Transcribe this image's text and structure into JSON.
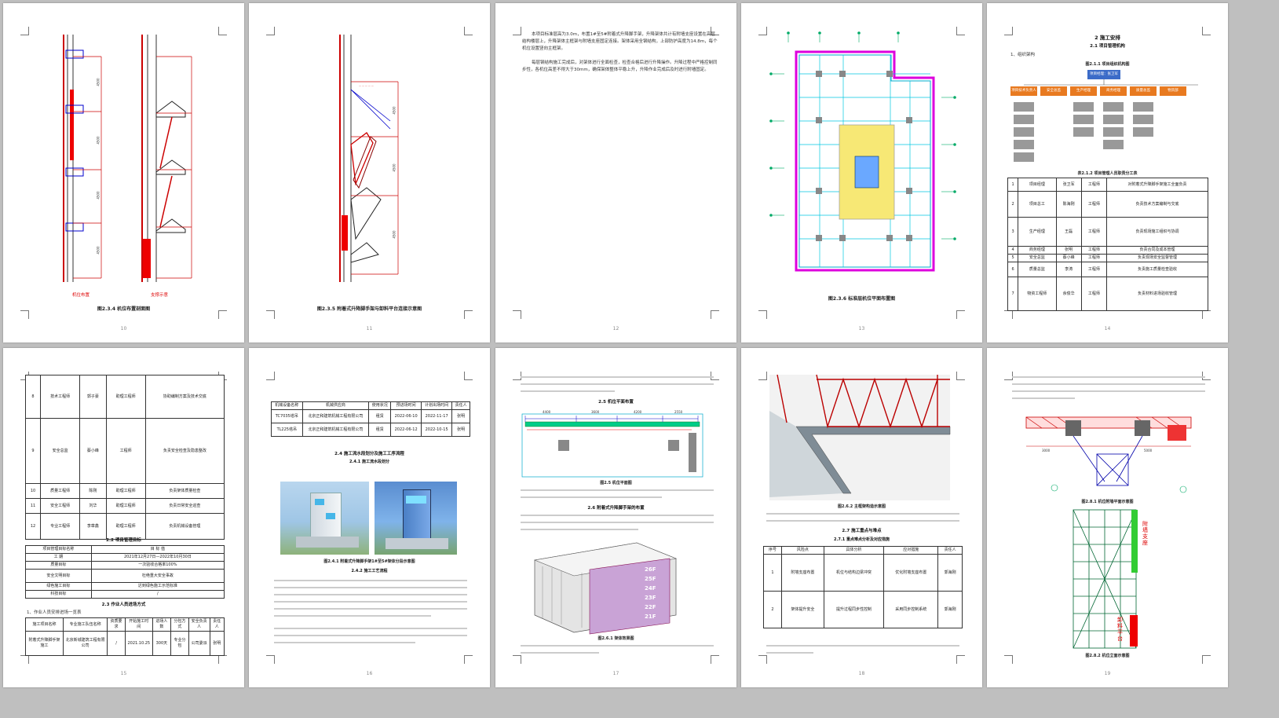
{
  "pages": [
    {
      "number": "10",
      "caption": "图2.3.4 机位布置剖面图",
      "labels": [
        "机位布置",
        "支撑示意"
      ],
      "dims": [
        "4500",
        "4500",
        "4500",
        "4500"
      ]
    },
    {
      "number": "11",
      "caption": "图2.3.5 附着式升降脚手架与卸料平台连接示意图",
      "dims": [
        "4500",
        "4500",
        "4500"
      ]
    },
    {
      "number": "12",
      "paragraphs": [
        "本项目标准层高为3.0m，布置1#至5#附着式升降脚手架，升降架体共计有附墙支座设置在高层结构楼层上，升降架体主框架与附墙支座固定连接。架体采用全钢结构，上部防护高度为14.8m，每个机位设置竖向主框架。",
        "每层钢结构施工完成后，对架体进行全面检查，检查合格后进行升降操作。升降过程中严格控制同步性，各机位高差不得大于30mm，确保架体整体平稳上升，升降作业完成后及时进行附墙固定。"
      ]
    },
    {
      "number": "13",
      "caption": "图2.3.6 标准层机位平面布置图"
    },
    {
      "number": "14",
      "heading": "2 施工安排",
      "subheading": "2.1 项目管理机构",
      "item": "1、组织架构",
      "chart_title": "图2.1.1 项目组织机构图",
      "table_title": "表2.1.2 项目管理人员职责分工表",
      "org_top": "项目经理：张卫军",
      "org_level2": [
        "项目技术负责人",
        "安全总监",
        "生产经理",
        "商务经理",
        "质量总监",
        "物资部"
      ],
      "table_rows": [
        {
          "no": "1",
          "role": "项目经理",
          "name": "张卫军",
          "title": "工程师",
          "duty": "对附着式升降脚手架施工全面负责"
        },
        {
          "no": "2",
          "role": "项目总工",
          "name": "陈海刚",
          "title": "工程师",
          "duty": "负责技术方案编制与交底"
        },
        {
          "no": "3",
          "role": "生产经理",
          "name": "王磊",
          "title": "工程师",
          "duty": "负责现场施工组织与协调"
        },
        {
          "no": "4",
          "role": "商务经理",
          "name": "张明",
          "title": "工程师",
          "duty": "负责合同及成本管理"
        },
        {
          "no": "5",
          "role": "安全总监",
          "name": "蔡小峰",
          "title": "工程师",
          "duty": "负责现场安全监督管理"
        },
        {
          "no": "6",
          "role": "质量总监",
          "name": "李涛",
          "title": "工程师",
          "duty": "负责施工质量检查验收"
        },
        {
          "no": "7",
          "role": "物资工程师",
          "name": "余俊华",
          "title": "工程师",
          "duty": "负责材料进场验收管理"
        }
      ]
    },
    {
      "number": "15",
      "table_rows": [
        {
          "no": "8",
          "role": "技术工程师",
          "name": "郭子豪",
          "title": "助理工程师",
          "duty": "协助编制方案及技术交底"
        },
        {
          "no": "9",
          "role": "安全总监",
          "name": "蔡小峰",
          "title": "工程师",
          "duty": "负责安全检查及隐患整改"
        },
        {
          "no": "10",
          "role": "质量工程师",
          "name": "陈刚",
          "title": "助理工程师",
          "duty": "负责架体质量检查"
        },
        {
          "no": "11",
          "role": "安全工程师",
          "name": "刘华",
          "title": "助理工程师",
          "duty": "负责日常安全巡查"
        },
        {
          "no": "12",
          "role": "专业工程师",
          "name": "李章鑫",
          "title": "助理工程师",
          "duty": "负责机械设备管理"
        }
      ],
      "section": "2.2 项目管理目标",
      "goal_header": [
        "项目管理目标名称",
        "目 标 值"
      ],
      "goals": [
        {
          "name": "工 期",
          "value": "2021年12月27日—2022年10月30日"
        },
        {
          "name": "质量目标",
          "value": "一次验收合格率100%"
        },
        {
          "name": "安全文明目标",
          "value": "杜绝重大安全事故"
        },
        {
          "name": "绿色施工目标",
          "value": "达到绿色施工示范标准"
        },
        {
          "name": "科技目标",
          "value": "/"
        }
      ],
      "section2": "2.3 作业人员进场方式",
      "sub": "1、作业人员安排进场一览表",
      "plan_header": [
        "施工项目名称",
        "专业施工队伍名称",
        "资质要求",
        "开始施工时间",
        "进场人数",
        "分包方式",
        "安全负责人",
        "责任人"
      ],
      "plan_row": [
        "附着式升降脚手架施工",
        "北京新城建筑工程有限公司",
        "/",
        "2021.10.25",
        "300天",
        "专业分包",
        "公司委派",
        "张明"
      ]
    },
    {
      "number": "16",
      "device_header": [
        "机械设备名称",
        "机械供应商",
        "使用状况",
        "预进场时间",
        "计划出场时间",
        "责任人"
      ],
      "devices": [
        [
          "TC7035塔吊",
          "北京正和建筑机械工程有限公司",
          "租赁",
          "2022-06-10",
          "2022-11-17",
          "张明"
        ],
        [
          "TL225塔吊",
          "北京正和建筑机械工程有限公司",
          "租赁",
          "2022-06-12",
          "2022-10-15",
          "张明"
        ]
      ],
      "section": "2.4 施工流水段划分及施工工序流程",
      "sub": "2.4.1 施工流水段划分",
      "caption": "图2.4.1 附着式升降脚手架1#至5#架体分段示意图",
      "sub2": "2.4.2 施工工艺流程"
    },
    {
      "number": "17",
      "section": "2.5 机位平面布置",
      "caption": "图2.5 机位平面图",
      "section2": "2.6 附着式升降脚手架的布置",
      "caption2": "图2.6.1 架体效果图",
      "floors": [
        "26F",
        "25F",
        "24F",
        "23F",
        "22F",
        "21F"
      ],
      "dims": [
        "4400",
        "3600",
        "4200",
        "2550"
      ]
    },
    {
      "number": "18",
      "caption": "图2.6.2 主框架构造示意图",
      "section": "2.7 施工重点与难点",
      "sub": "2.7.1 重点难点分析及对应措施",
      "risk_header": [
        "序号",
        "风险点",
        "具体分析",
        "应对措施",
        "责任人"
      ],
      "risks": [
        {
          "no": "1",
          "point": "附墙支座布置",
          "analysis": "机位与结构边梁冲突",
          "measure": "优化附墙支座布置",
          "owner": "郭海刚"
        },
        {
          "no": "2",
          "point": "架体提升安全",
          "analysis": "提升过程同步性控制",
          "measure": "采用同步控制系统",
          "owner": "郭海刚"
        }
      ]
    },
    {
      "number": "19",
      "caption": "图2.8.1 机位附墙平面示意图",
      "caption2": "图2.8.2 机位立面示意图",
      "labels": [
        "附墙支座",
        "卸料平台"
      ],
      "dims": [
        "3000",
        "5000"
      ]
    }
  ]
}
